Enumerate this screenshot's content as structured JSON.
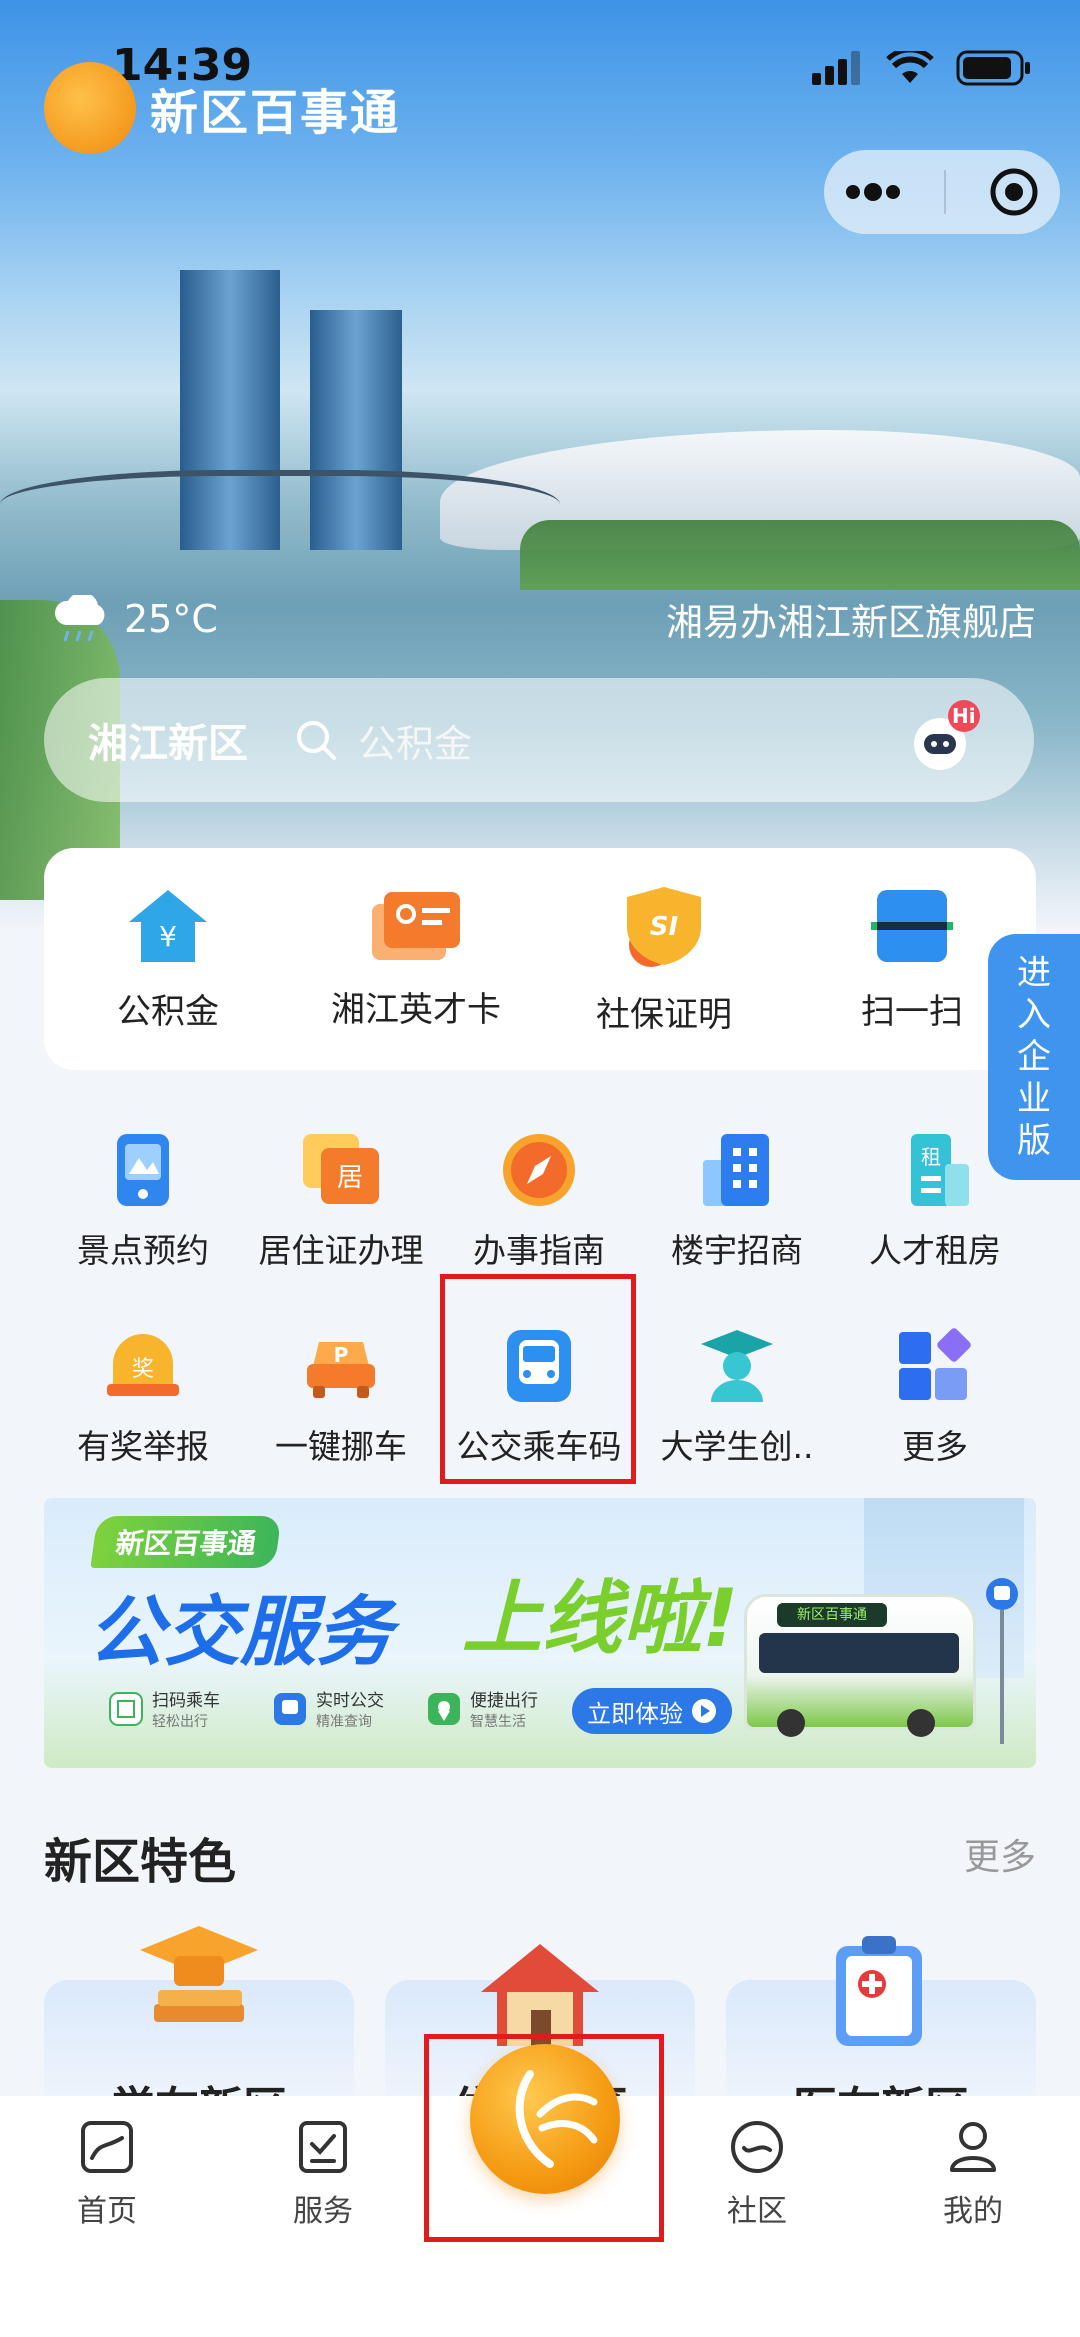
{
  "status_bar": {
    "time": "14:39"
  },
  "app": {
    "title": "新区百事通"
  },
  "hero": {
    "temperature": "25°C",
    "store_name": "湘易办湘江新区旗舰店"
  },
  "search": {
    "region": "湘江新区",
    "placeholder": "公积金",
    "robot_badge": "Hi"
  },
  "quick_actions": [
    {
      "label": "公积金",
      "icon": "housing-fund-icon"
    },
    {
      "label": "湘江英才卡",
      "icon": "talent-card-icon"
    },
    {
      "label": "社保证明",
      "icon": "social-security-icon"
    },
    {
      "label": "扫一扫",
      "icon": "scan-icon"
    }
  ],
  "enterprise_tab": {
    "label": "进入企业版"
  },
  "services_row1": [
    {
      "label": "景点预约"
    },
    {
      "label": "居住证办理"
    },
    {
      "label": "办事指南"
    },
    {
      "label": "楼宇招商"
    },
    {
      "label": "人才租房"
    }
  ],
  "services_row2": [
    {
      "label": "有奖举报"
    },
    {
      "label": "一键挪车"
    },
    {
      "label": "公交乘车码"
    },
    {
      "label": "大学生创.."
    },
    {
      "label": "更多"
    }
  ],
  "banner": {
    "tag": "新区百事通",
    "title_part1": "公交服务",
    "title_part2": "上线啦!",
    "features": [
      {
        "title": "扫码乘车",
        "sub": "轻松出行"
      },
      {
        "title": "实时公交",
        "sub": "精准查询"
      },
      {
        "title": "便捷出行",
        "sub": "智慧生活"
      }
    ],
    "cta": "立即体验",
    "bus_sign": "新区百事通"
  },
  "features_section": {
    "title": "新区特色",
    "more": "更多",
    "cards": [
      {
        "label": "学在新区"
      },
      {
        "label": "住在新区"
      },
      {
        "label": "医在新区"
      }
    ]
  },
  "tab_bar": [
    {
      "label": "首页",
      "icon": "home-icon"
    },
    {
      "label": "服务",
      "icon": "service-icon"
    },
    {
      "label": "",
      "icon": "app-logo-icon"
    },
    {
      "label": "社区",
      "icon": "community-icon"
    },
    {
      "label": "我的",
      "icon": "profile-icon"
    }
  ],
  "colors": {
    "accent": "#3f95ee",
    "brand_orange": "#f59a12",
    "highlight_red": "#e01b1b"
  }
}
